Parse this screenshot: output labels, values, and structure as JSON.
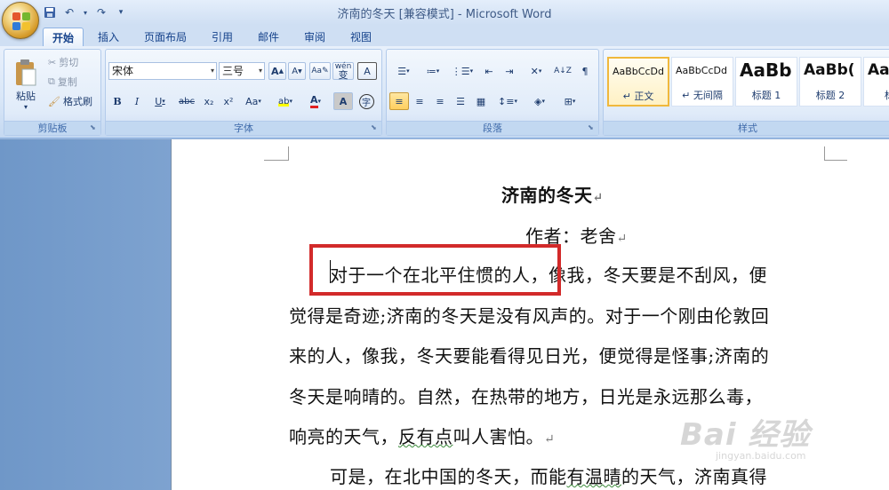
{
  "window": {
    "title": "济南的冬天 [兼容模式] - Microsoft Word"
  },
  "quick_access": {
    "icons": [
      "save-icon",
      "undo-icon",
      "redo-icon",
      "customize-qat-icon"
    ]
  },
  "tabs": [
    "开始",
    "插入",
    "页面布局",
    "引用",
    "邮件",
    "审阅",
    "视图"
  ],
  "active_tab": "开始",
  "ribbon": {
    "clipboard": {
      "label": "剪贴板",
      "paste": "粘贴",
      "cut": "剪切",
      "copy": "复制",
      "format_painter": "格式刷"
    },
    "font": {
      "label": "字体",
      "font_name": "宋体",
      "font_size": "三号",
      "bold": "B",
      "italic": "I",
      "underline": "U",
      "strikethrough": "abc",
      "subscript": "x₂",
      "superscript": "x²",
      "change_case": "Aa",
      "font_color": "A",
      "char_shading": "A",
      "grow": "A",
      "shrink": "A",
      "highlight": "ab",
      "phonetic": "wén",
      "phonetic_char": "变",
      "border_char": "A",
      "enclose": "字"
    },
    "paragraph": {
      "label": "段落"
    },
    "styles": {
      "label": "样式",
      "items": [
        {
          "sample": "AaBbCcDd",
          "name": "↵ 正文"
        },
        {
          "sample": "AaBbCcDd",
          "name": "↵ 无间隔"
        },
        {
          "sample": "AaBb",
          "name": "标题 1"
        },
        {
          "sample": "AaBb(",
          "name": "标题 2"
        },
        {
          "sample": "AaB",
          "name": "标题"
        }
      ]
    }
  },
  "document": {
    "title": "济南的冬天",
    "author": "作者：老舍",
    "para1_lines": [
      "对于一个在北平住惯的人，像我，冬天要是不刮风，便",
      "觉得是奇迹;济南的冬天是没有风声的。对于一个刚由伦敦回",
      "来的人，像我，冬天要能看得见日光，便觉得是怪事;济南的",
      "冬天是响晴的。自然，在热带的地方，日光是永远那么毒，"
    ],
    "para1_last_a": "响亮的天气，",
    "para1_last_b": "反有点",
    "para1_last_c": "叫人害怕。",
    "para2_a": "可是，在北中国的冬天，而能",
    "para2_b": "有温晴",
    "para2_c": "的天气，济南真得",
    "para_mark": "↵"
  },
  "watermark": {
    "main": "Bai 经验",
    "sub": "jingyan.baidu.com"
  },
  "colors": {
    "highlight_box": "#d22a2a",
    "ribbon_bg": "#dbe8f8",
    "spellcheck": "#3a8a3a"
  }
}
